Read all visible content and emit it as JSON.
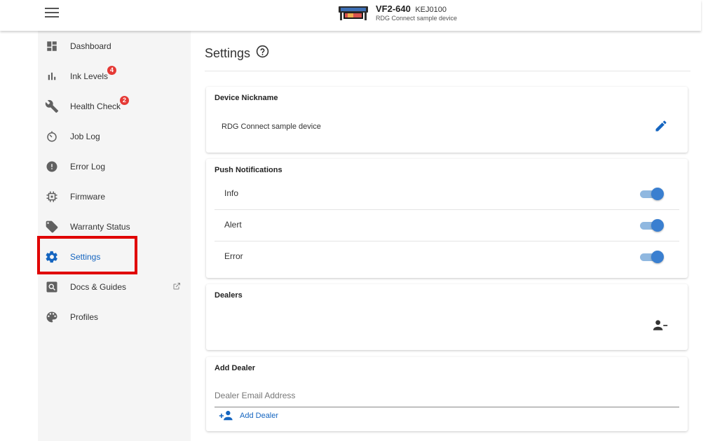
{
  "device": {
    "model": "VF2-640",
    "serial": "KEJ0100",
    "subtitle": "RDG Connect sample device"
  },
  "sidebar": {
    "items": [
      {
        "label": "Dashboard",
        "icon": "dashboard-icon"
      },
      {
        "label": "Ink Levels",
        "icon": "bar-chart-icon",
        "badge": "4"
      },
      {
        "label": "Health Check",
        "icon": "wrench-icon",
        "badge": "2"
      },
      {
        "label": "Job Log",
        "icon": "timer-icon"
      },
      {
        "label": "Error Log",
        "icon": "error-icon"
      },
      {
        "label": "Firmware",
        "icon": "chip-icon"
      },
      {
        "label": "Warranty Status",
        "icon": "tag-icon"
      },
      {
        "label": "Settings",
        "icon": "gear-icon",
        "active": true
      },
      {
        "label": "Docs & Guides",
        "icon": "doc-search-icon",
        "external": true
      },
      {
        "label": "Profiles",
        "icon": "palette-icon"
      }
    ]
  },
  "page": {
    "title": "Settings"
  },
  "nickname": {
    "title": "Device Nickname",
    "value": "RDG Connect sample device"
  },
  "notifications": {
    "title": "Push Notifications",
    "rows": [
      {
        "label": "Info",
        "enabled": true
      },
      {
        "label": "Alert",
        "enabled": true
      },
      {
        "label": "Error",
        "enabled": true
      }
    ]
  },
  "dealers": {
    "title": "Dealers"
  },
  "add_dealer": {
    "title": "Add Dealer",
    "placeholder": "Dealer Email Address",
    "button_label": "Add Dealer"
  },
  "colors": {
    "accent": "#1565c0",
    "toggle_on": "#3a7fd0",
    "badge": "#e53935",
    "highlight": "#e00000"
  }
}
